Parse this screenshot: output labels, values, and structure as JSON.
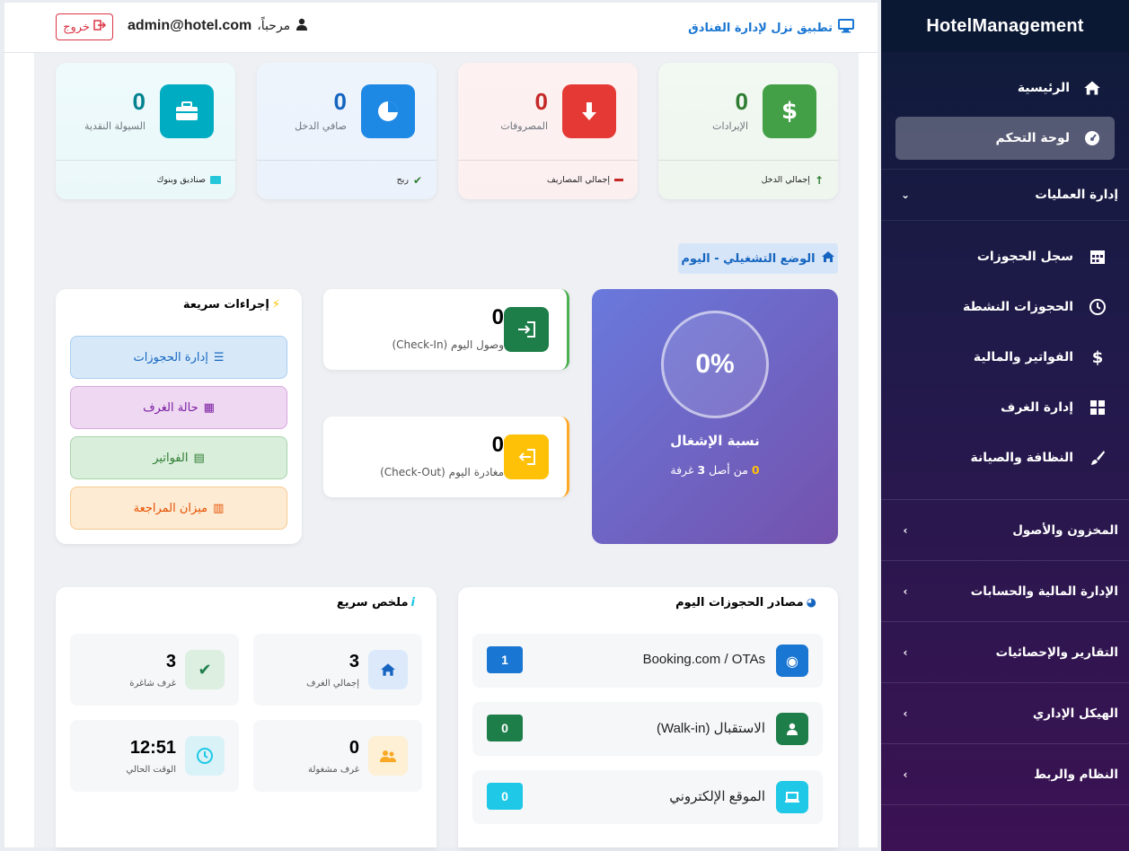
{
  "sidebar": {
    "brand": "HotelManagement",
    "items": [
      {
        "label": "الرئيسية",
        "icon": "home-icon"
      },
      {
        "label": "لوحة التحكم",
        "icon": "dashboard-icon",
        "active": true
      }
    ],
    "operations": {
      "label": "إدارة العمليات",
      "items": [
        {
          "label": "سجل الحجوزات",
          "icon": "calendar-icon"
        },
        {
          "label": "الحجوزات النشطة",
          "icon": "clock-icon"
        },
        {
          "label": "الفواتير والمالية",
          "icon": "dollar-icon"
        },
        {
          "label": "إدارة الغرف",
          "icon": "grid-icon"
        },
        {
          "label": "النظافة والصيانة",
          "icon": "brush-icon"
        }
      ]
    },
    "sections": [
      {
        "label": "المخزون والأصول"
      },
      {
        "label": "الإدارة المالية والحسابات"
      },
      {
        "label": "التقارير والإحصائيات"
      },
      {
        "label": "الهيكل الإداري"
      },
      {
        "label": "النظام والربط"
      }
    ]
  },
  "topbar": {
    "app_title": "تطبيق نزل لإدارة الفنادق",
    "welcome": "مرحباً،",
    "user": "admin@hotel.com",
    "logout": "خروج"
  },
  "stats": [
    {
      "value": "0",
      "label": "الإيرادات",
      "footer": "إجمالي الدخل",
      "color": "#43a047",
      "val_color": "#2e7d32"
    },
    {
      "value": "0",
      "label": "المصروفات",
      "footer": "إجمالي المصاريف",
      "color": "#e53935",
      "val_color": "#c62828"
    },
    {
      "value": "0",
      "label": "صافي الدخل",
      "footer": "ربح",
      "color": "#1e88e5",
      "val_color": "#1565c0"
    },
    {
      "value": "0",
      "label": "السيولة النقدية",
      "footer": "صناديق وبنوك",
      "color": "#00acc1",
      "val_color": "#00838f"
    }
  ],
  "status": {
    "label": "الوضع التشغيلي - اليوم"
  },
  "occupancy": {
    "percent": "0%",
    "title": "نسبة الإشغال",
    "occupied": "0",
    "of_text": "من أصل",
    "total": "3",
    "unit": "غرفة"
  },
  "arrivals": {
    "value": "0",
    "label": "وصول اليوم (Check-In)"
  },
  "departures": {
    "value": "0",
    "label": "مغادرة اليوم (Check-Out)"
  },
  "quick_actions": {
    "title": "إجراءات سريعة",
    "buttons": [
      {
        "label": "إدارة الحجوزات"
      },
      {
        "label": "حالة الغرف"
      },
      {
        "label": "الفواتير"
      },
      {
        "label": "ميزان المراجعة"
      }
    ]
  },
  "sources": {
    "title": "مصادر الحجوزات اليوم",
    "items": [
      {
        "name": "Booking.com / OTAs",
        "count": "1"
      },
      {
        "name": "الاستقبال (Walk-in)",
        "count": "0"
      },
      {
        "name": "الموقع الإلكتروني",
        "count": "0"
      }
    ]
  },
  "summary": {
    "title": "ملخص سريع",
    "items": [
      {
        "value": "3",
        "label": "إجمالي الغرف"
      },
      {
        "value": "3",
        "label": "غرف شاغرة"
      },
      {
        "value": "0",
        "label": "غرف مشغولة"
      },
      {
        "value": "12:51",
        "label": "الوقت الحالي"
      }
    ]
  }
}
